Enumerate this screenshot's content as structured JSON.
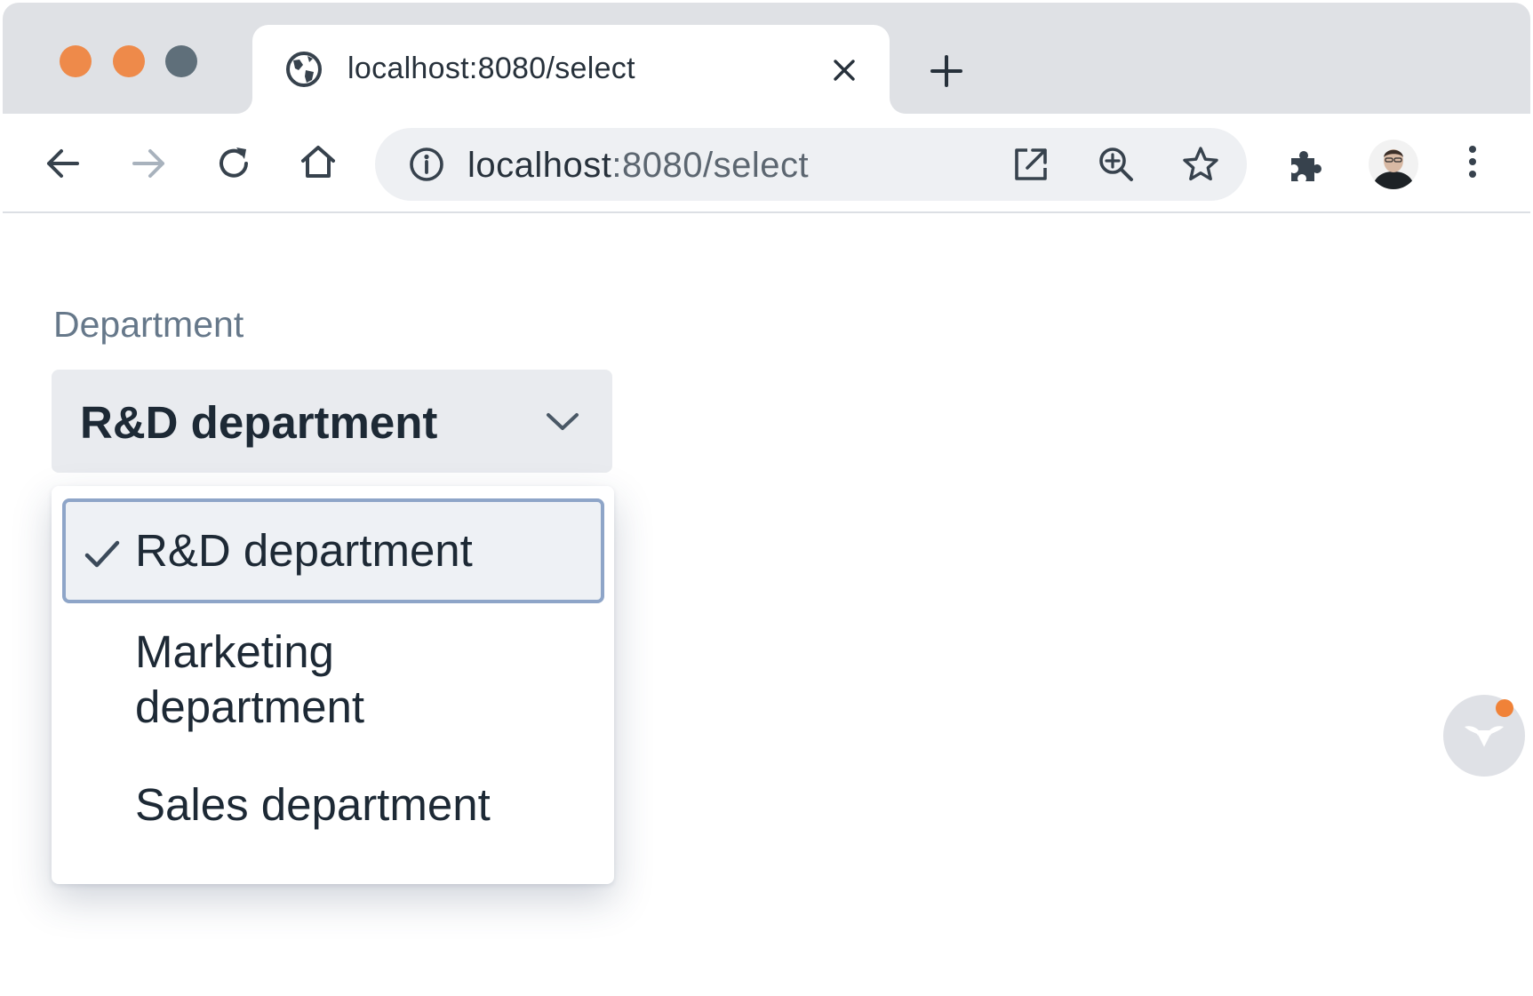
{
  "browser": {
    "tab_title": "localhost:8080/select",
    "url_host": "localhost",
    "url_rest": ":8080/select",
    "icons": {
      "back": "arrow-left-icon",
      "forward": "arrow-right-icon",
      "reload": "reload-icon",
      "home": "home-icon",
      "site_info": "info-icon",
      "open_external": "open-external-icon",
      "zoom": "zoom-in-icon",
      "bookmark": "star-icon",
      "extensions": "puzzle-icon",
      "menu": "kebab-menu-icon"
    },
    "traffic_colors": [
      "#ee8a4a",
      "#ee8a4a",
      "#5f6f7a"
    ]
  },
  "page": {
    "field_label": "Department",
    "selected_value": "R&D department",
    "options": [
      {
        "label": "R&D department",
        "selected": true
      },
      {
        "label": "Marketing department",
        "selected": false
      },
      {
        "label": "Sales department",
        "selected": false
      }
    ],
    "accent_color": "#8ea5c8",
    "badge_dot_color": "#f08238"
  }
}
